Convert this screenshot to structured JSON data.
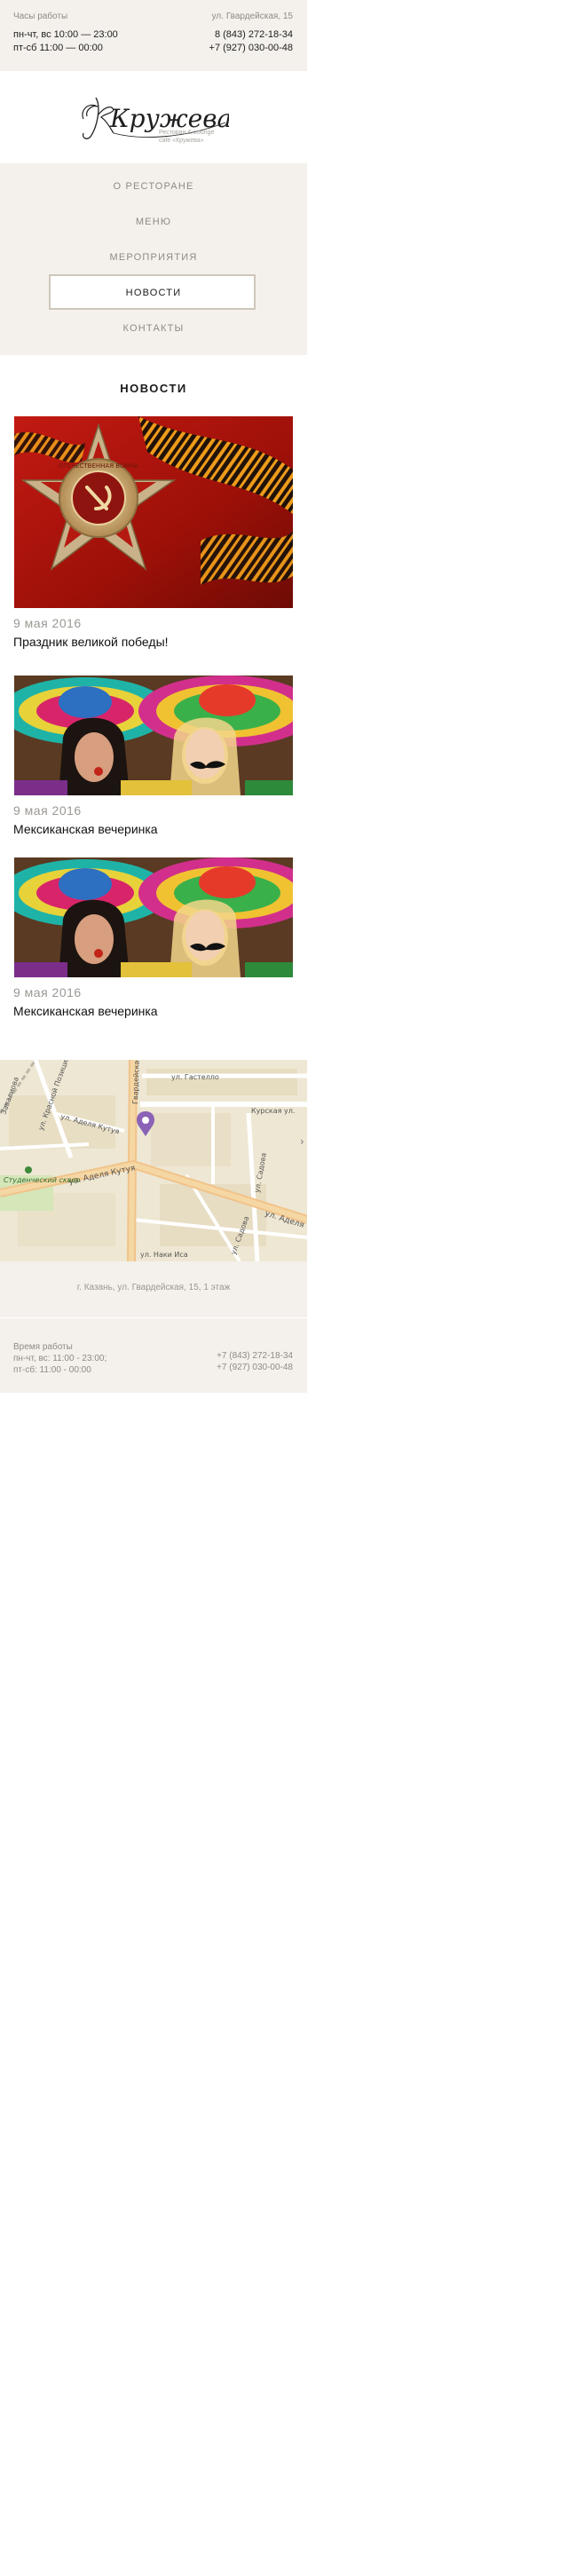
{
  "topbar": {
    "hours_label": "Часы работы",
    "hours_line1": "пн-чт, вс 10:00 — 23:00",
    "hours_line2": "пт-сб 11:00 — 00:00",
    "address": "ул. Гвардейская, 15",
    "phone1": "8 (843) 272-18-34",
    "phone2": "+7 (927) 030-00-48"
  },
  "logo": {
    "script_text": "Кружева",
    "sub_line1": "Ресторан & Lounge",
    "sub_line2": "cafe «Кружева»"
  },
  "nav": {
    "items": [
      {
        "label": "О РЕСТОРАНЕ",
        "active": false
      },
      {
        "label": "МЕНЮ",
        "active": false
      },
      {
        "label": "МЕРОПРИЯТИЯ",
        "active": false
      },
      {
        "label": "НОВОСТИ",
        "active": true
      },
      {
        "label": "КОНТАКТЫ",
        "active": false
      }
    ]
  },
  "page": {
    "title": "НОВОСТИ"
  },
  "news": [
    {
      "date": "9 мая 2016",
      "title": "Праздник великой победы!",
      "image": "order-of-patriotic-war-image"
    },
    {
      "date": "9 мая 2016",
      "title": "Мексиканская вечеринка",
      "image": "mexican-party-image"
    },
    {
      "date": "9 мая 2016",
      "title": "Мексиканская вечеринка",
      "image": "mexican-party-image"
    }
  ],
  "order_badge_text": "ОТЕЧЕСТВЕННАЯ ВОЙНА",
  "map": {
    "streets": {
      "gastello": "ул. Гастелло",
      "kurskaya": "Курская ул.",
      "gvardeyskaya": "Гвардейская ул.",
      "krasnoy_pozitsii": "ул. Красной Позиции",
      "adelya_kutuya_1": "ул. Аделя Кутуя",
      "adelya_kutuya_2": "ул. Аделя Кутуя",
      "adelya_kutuya_3": "ул. Аделя",
      "sadovaya_1": "ул. Садова",
      "sadovaya_2": "ул. Садова",
      "naki_isan": "ул. Наки Иса",
      "zavalikova": "Завалиова"
    },
    "park": "Студенческий сквер",
    "marker_color": "#8a62b6"
  },
  "address_band": {
    "text": "г. Казань, ул. Гвардейская, 15, 1 этаж"
  },
  "footer": {
    "label": "Время работы",
    "line1": "пн-чт, вс: 11:00 - 23:00;",
    "line2": "пт-сб: 11:00 - 00:00",
    "phone1": "+7 (843) 272-18-34",
    "phone2": "+7 (927) 030-00-48"
  },
  "colors": {
    "band_bg": "#f4f1ec",
    "muted_text": "#8e8a84",
    "active_border": "#cfc6bb"
  }
}
